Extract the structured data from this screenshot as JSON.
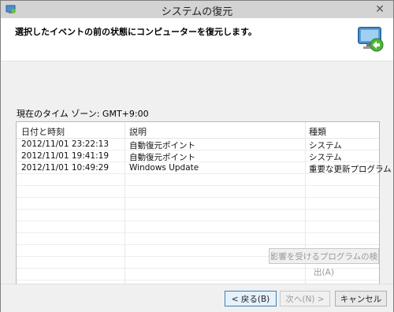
{
  "window": {
    "title": "システムの復元"
  },
  "header": {
    "instruction": "選択したイベントの前の状態にコンピューターを復元します。"
  },
  "timezone_label": "現在のタイム ゾーン: GMT+9:00",
  "table": {
    "columns": [
      "日付と時刻",
      "説明",
      "種類"
    ],
    "rows": [
      [
        "2012/11/01 23:22:13",
        "自動復元ポイント",
        "システム"
      ],
      [
        "2012/11/01 19:41:19",
        "自動復元ポイント",
        "システム"
      ],
      [
        "2012/11/01 10:49:29",
        "Windows Update",
        "重要な更新プログラム"
      ]
    ]
  },
  "buttons": {
    "scan": "影響を受けるプログラムの検出(A)",
    "back": "< 戻る(B)",
    "next": "次へ(N) >",
    "cancel": "キャンセル"
  }
}
